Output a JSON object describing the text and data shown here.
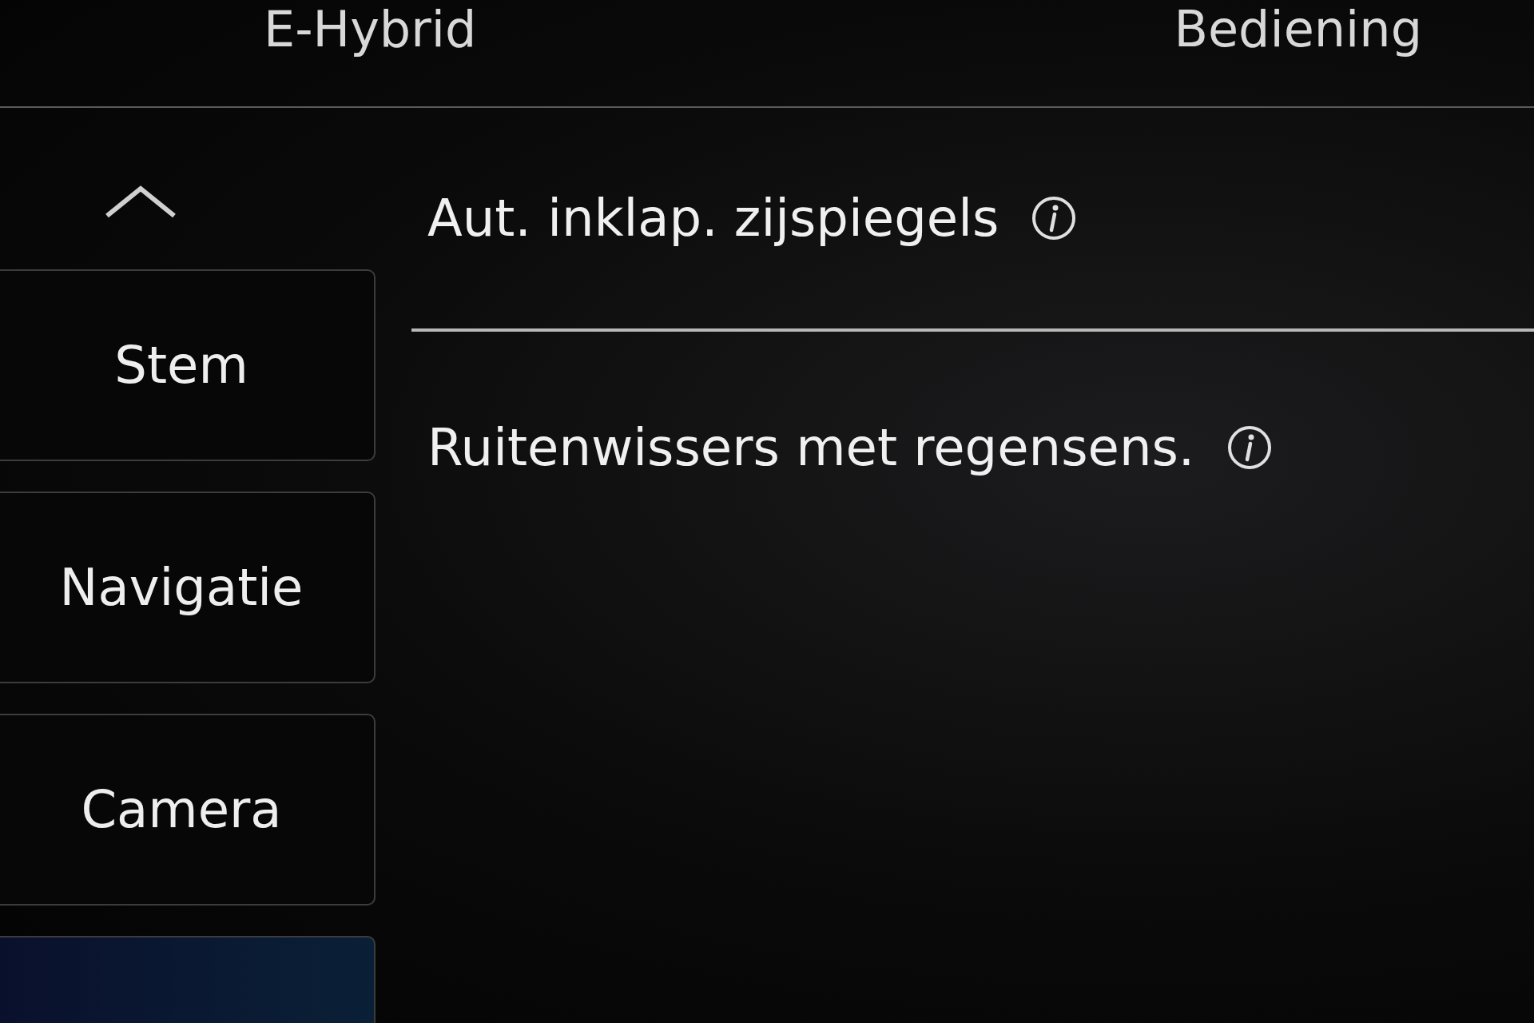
{
  "header": {
    "title": "E-Hybrid",
    "section": "Bediening"
  },
  "sidebar": {
    "items": [
      {
        "label": "Stem",
        "selected": false
      },
      {
        "label": "Navigatie",
        "selected": false
      },
      {
        "label": "Camera",
        "selected": false
      },
      {
        "selected": true
      }
    ]
  },
  "settings": [
    {
      "label": "Aut. inklap. zijspiegels"
    },
    {
      "label": "Ruitenwissers met regensens."
    }
  ]
}
